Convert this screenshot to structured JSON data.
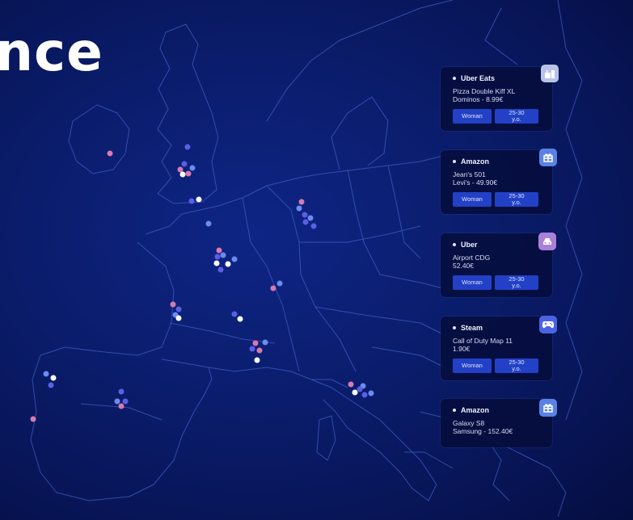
{
  "hero": {
    "title": "nce"
  },
  "colors": {
    "dot_pink": "#d77ab0",
    "dot_blue": "#6a8cf2",
    "dot_violet": "#5a5fe4",
    "dot_white": "#ffffff",
    "tag": "#2341c6"
  },
  "cards": [
    {
      "service": "Uber Eats",
      "item": "Pizza Double Kiff XL\nDominos - 8.99€",
      "gender": "Woman",
      "age": "25-30\ny.o.",
      "icon": "food-drink-icon",
      "badge_color": "#b9c3e8"
    },
    {
      "service": "Amazon",
      "item": "Jean's 501\nLevi's - 49.90€",
      "gender": "Woman",
      "age": "25-30\ny.o.",
      "icon": "gift-icon",
      "badge_color": "#5a82e6"
    },
    {
      "service": "Uber",
      "item": "Airport CDG\n52.40€",
      "gender": "Woman",
      "age": "25-30\ny.o.",
      "icon": "car-icon",
      "badge_color": "#a981d8"
    },
    {
      "service": "Steam",
      "item": "Call of Duty Map 11\n1.90€",
      "gender": "Woman",
      "age": "25-30\ny.o.",
      "icon": "gamepad-icon",
      "badge_color": "#4b63e2"
    },
    {
      "service": "Amazon",
      "item": "Galaxy S8\nSamsung - 152.40€",
      "gender": "",
      "age": "",
      "icon": "gift-icon",
      "badge_color": "#5a82e6"
    }
  ]
}
